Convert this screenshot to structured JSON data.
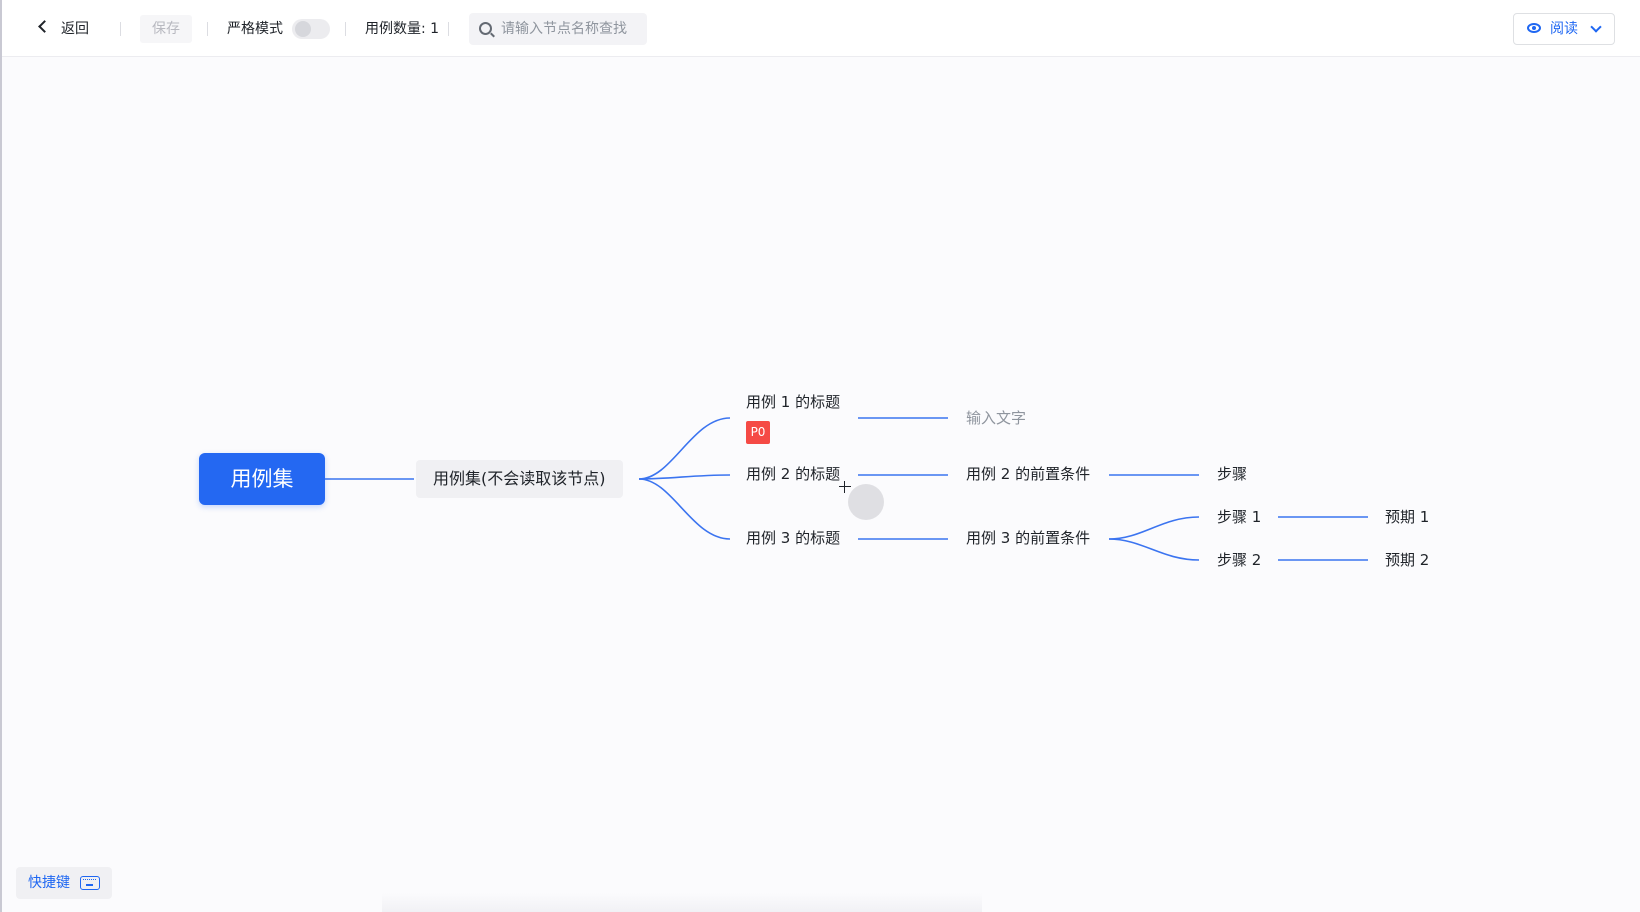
{
  "toolbar": {
    "back_label": "返回",
    "save_label": "保存",
    "strict_mode_label": "严格模式",
    "strict_mode_on": false,
    "case_count_label": "用例数量: 1",
    "search_placeholder": "请输入节点名称查找",
    "view_mode_label": "阅读"
  },
  "mindmap": {
    "root": "用例集",
    "case_set": "用例集(不会读取该节点)",
    "cases": [
      {
        "title": "用例 1 的标题",
        "priority": "P0",
        "precondition_placeholder": "输入文字"
      },
      {
        "title": "用例 2 的标题",
        "precondition": "用例 2 的前置条件",
        "steps": [
          {
            "step": "步骤"
          }
        ]
      },
      {
        "title": "用例 3 的标题",
        "precondition": "用例 3 的前置条件",
        "steps": [
          {
            "step": "步骤 1",
            "expected": "预期 1"
          },
          {
            "step": "步骤 2",
            "expected": "预期 2"
          }
        ]
      }
    ]
  },
  "shortcut_label": "快捷键",
  "colors": {
    "accent": "#2468f2",
    "link": "#3b74f0",
    "priority_p0": "#f54a45"
  }
}
